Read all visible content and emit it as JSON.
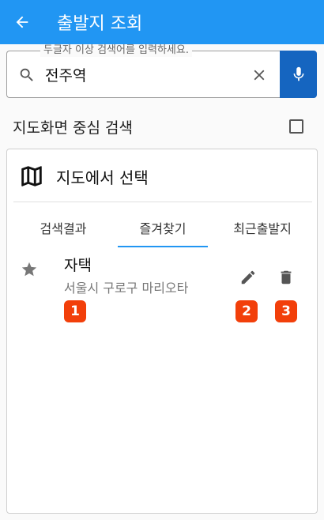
{
  "appbar": {
    "title": "출발지 조회",
    "back_icon": "arrow-back-icon"
  },
  "search": {
    "legend": "두글자 이상 검색어를 입력하세요.",
    "value": "전주역",
    "icons": [
      "search-icon",
      "clear-icon",
      "mic-icon"
    ]
  },
  "center_search": {
    "label": "지도화면 중심 검색",
    "checked": false
  },
  "map_select": {
    "label": "지도에서 선택",
    "icon": "map-icon"
  },
  "tabs": [
    {
      "label": "검색결과",
      "active": false
    },
    {
      "label": "즐겨찾기",
      "active": true
    },
    {
      "label": "최근출발지",
      "active": false
    }
  ],
  "favorites": [
    {
      "name": "자택",
      "address": "서울시 구로구 마리오타"
    }
  ],
  "badges": [
    "1",
    "2",
    "3"
  ],
  "colors": {
    "appbar": "#2196f3",
    "mic": "#1565c0",
    "badge": "#f23f0a",
    "tab_indicator": "#2196f3"
  }
}
